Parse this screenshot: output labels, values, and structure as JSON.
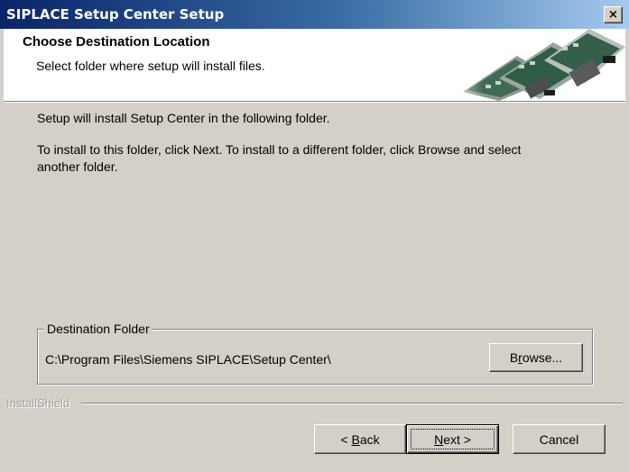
{
  "window": {
    "title": "SIPLACE Setup Center Setup",
    "close_glyph": "×"
  },
  "header": {
    "title": "Choose Destination Location",
    "subtitle": "Select folder where setup will install files.",
    "banner_icon": "pcb-machine-graphic"
  },
  "body": {
    "line1": "Setup will install Setup Center in the following folder.",
    "line2a": "To install to this folder, click Next. To install to a different folder, click Browse and select",
    "line2b": "another folder."
  },
  "destination": {
    "group_label": "Destination Folder",
    "path": "C:\\Program Files\\Siemens SIPLACE\\Setup Center\\",
    "browse_pre": "B",
    "browse_mnemonic": "r",
    "browse_post": "owse..."
  },
  "footer": {
    "brand": "InstallShield",
    "back_pre": "< ",
    "back_mnemonic": "B",
    "back_post": "ack",
    "next_mnemonic": "N",
    "next_post": "ext >",
    "cancel_label": "Cancel"
  }
}
